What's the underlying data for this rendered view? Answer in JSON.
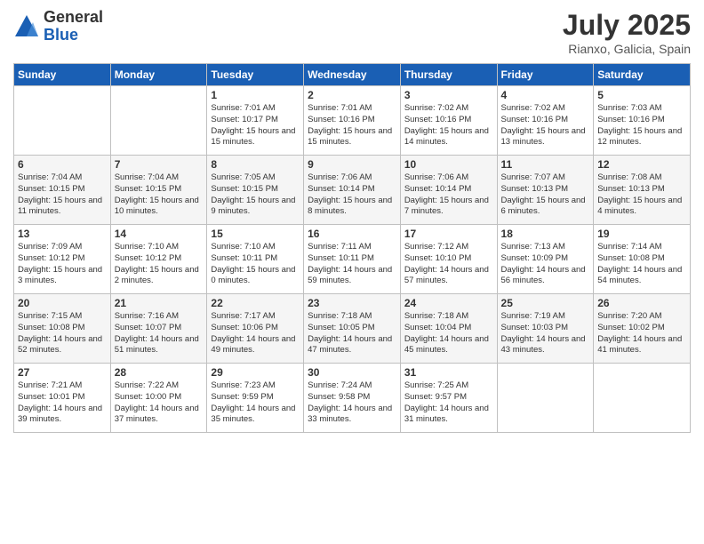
{
  "logo": {
    "general": "General",
    "blue": "Blue"
  },
  "header": {
    "month_year": "July 2025",
    "location": "Rianxo, Galicia, Spain"
  },
  "weekdays": [
    "Sunday",
    "Monday",
    "Tuesday",
    "Wednesday",
    "Thursday",
    "Friday",
    "Saturday"
  ],
  "weeks": [
    [
      {
        "day": null
      },
      {
        "day": null
      },
      {
        "day": "1",
        "sunrise": "Sunrise: 7:01 AM",
        "sunset": "Sunset: 10:17 PM",
        "daylight": "Daylight: 15 hours and 15 minutes."
      },
      {
        "day": "2",
        "sunrise": "Sunrise: 7:01 AM",
        "sunset": "Sunset: 10:16 PM",
        "daylight": "Daylight: 15 hours and 15 minutes."
      },
      {
        "day": "3",
        "sunrise": "Sunrise: 7:02 AM",
        "sunset": "Sunset: 10:16 PM",
        "daylight": "Daylight: 15 hours and 14 minutes."
      },
      {
        "day": "4",
        "sunrise": "Sunrise: 7:02 AM",
        "sunset": "Sunset: 10:16 PM",
        "daylight": "Daylight: 15 hours and 13 minutes."
      },
      {
        "day": "5",
        "sunrise": "Sunrise: 7:03 AM",
        "sunset": "Sunset: 10:16 PM",
        "daylight": "Daylight: 15 hours and 12 minutes."
      }
    ],
    [
      {
        "day": "6",
        "sunrise": "Sunrise: 7:04 AM",
        "sunset": "Sunset: 10:15 PM",
        "daylight": "Daylight: 15 hours and 11 minutes."
      },
      {
        "day": "7",
        "sunrise": "Sunrise: 7:04 AM",
        "sunset": "Sunset: 10:15 PM",
        "daylight": "Daylight: 15 hours and 10 minutes."
      },
      {
        "day": "8",
        "sunrise": "Sunrise: 7:05 AM",
        "sunset": "Sunset: 10:15 PM",
        "daylight": "Daylight: 15 hours and 9 minutes."
      },
      {
        "day": "9",
        "sunrise": "Sunrise: 7:06 AM",
        "sunset": "Sunset: 10:14 PM",
        "daylight": "Daylight: 15 hours and 8 minutes."
      },
      {
        "day": "10",
        "sunrise": "Sunrise: 7:06 AM",
        "sunset": "Sunset: 10:14 PM",
        "daylight": "Daylight: 15 hours and 7 minutes."
      },
      {
        "day": "11",
        "sunrise": "Sunrise: 7:07 AM",
        "sunset": "Sunset: 10:13 PM",
        "daylight": "Daylight: 15 hours and 6 minutes."
      },
      {
        "day": "12",
        "sunrise": "Sunrise: 7:08 AM",
        "sunset": "Sunset: 10:13 PM",
        "daylight": "Daylight: 15 hours and 4 minutes."
      }
    ],
    [
      {
        "day": "13",
        "sunrise": "Sunrise: 7:09 AM",
        "sunset": "Sunset: 10:12 PM",
        "daylight": "Daylight: 15 hours and 3 minutes."
      },
      {
        "day": "14",
        "sunrise": "Sunrise: 7:10 AM",
        "sunset": "Sunset: 10:12 PM",
        "daylight": "Daylight: 15 hours and 2 minutes."
      },
      {
        "day": "15",
        "sunrise": "Sunrise: 7:10 AM",
        "sunset": "Sunset: 10:11 PM",
        "daylight": "Daylight: 15 hours and 0 minutes."
      },
      {
        "day": "16",
        "sunrise": "Sunrise: 7:11 AM",
        "sunset": "Sunset: 10:11 PM",
        "daylight": "Daylight: 14 hours and 59 minutes."
      },
      {
        "day": "17",
        "sunrise": "Sunrise: 7:12 AM",
        "sunset": "Sunset: 10:10 PM",
        "daylight": "Daylight: 14 hours and 57 minutes."
      },
      {
        "day": "18",
        "sunrise": "Sunrise: 7:13 AM",
        "sunset": "Sunset: 10:09 PM",
        "daylight": "Daylight: 14 hours and 56 minutes."
      },
      {
        "day": "19",
        "sunrise": "Sunrise: 7:14 AM",
        "sunset": "Sunset: 10:08 PM",
        "daylight": "Daylight: 14 hours and 54 minutes."
      }
    ],
    [
      {
        "day": "20",
        "sunrise": "Sunrise: 7:15 AM",
        "sunset": "Sunset: 10:08 PM",
        "daylight": "Daylight: 14 hours and 52 minutes."
      },
      {
        "day": "21",
        "sunrise": "Sunrise: 7:16 AM",
        "sunset": "Sunset: 10:07 PM",
        "daylight": "Daylight: 14 hours and 51 minutes."
      },
      {
        "day": "22",
        "sunrise": "Sunrise: 7:17 AM",
        "sunset": "Sunset: 10:06 PM",
        "daylight": "Daylight: 14 hours and 49 minutes."
      },
      {
        "day": "23",
        "sunrise": "Sunrise: 7:18 AM",
        "sunset": "Sunset: 10:05 PM",
        "daylight": "Daylight: 14 hours and 47 minutes."
      },
      {
        "day": "24",
        "sunrise": "Sunrise: 7:18 AM",
        "sunset": "Sunset: 10:04 PM",
        "daylight": "Daylight: 14 hours and 45 minutes."
      },
      {
        "day": "25",
        "sunrise": "Sunrise: 7:19 AM",
        "sunset": "Sunset: 10:03 PM",
        "daylight": "Daylight: 14 hours and 43 minutes."
      },
      {
        "day": "26",
        "sunrise": "Sunrise: 7:20 AM",
        "sunset": "Sunset: 10:02 PM",
        "daylight": "Daylight: 14 hours and 41 minutes."
      }
    ],
    [
      {
        "day": "27",
        "sunrise": "Sunrise: 7:21 AM",
        "sunset": "Sunset: 10:01 PM",
        "daylight": "Daylight: 14 hours and 39 minutes."
      },
      {
        "day": "28",
        "sunrise": "Sunrise: 7:22 AM",
        "sunset": "Sunset: 10:00 PM",
        "daylight": "Daylight: 14 hours and 37 minutes."
      },
      {
        "day": "29",
        "sunrise": "Sunrise: 7:23 AM",
        "sunset": "Sunset: 9:59 PM",
        "daylight": "Daylight: 14 hours and 35 minutes."
      },
      {
        "day": "30",
        "sunrise": "Sunrise: 7:24 AM",
        "sunset": "Sunset: 9:58 PM",
        "daylight": "Daylight: 14 hours and 33 minutes."
      },
      {
        "day": "31",
        "sunrise": "Sunrise: 7:25 AM",
        "sunset": "Sunset: 9:57 PM",
        "daylight": "Daylight: 14 hours and 31 minutes."
      },
      {
        "day": null
      },
      {
        "day": null
      }
    ]
  ]
}
